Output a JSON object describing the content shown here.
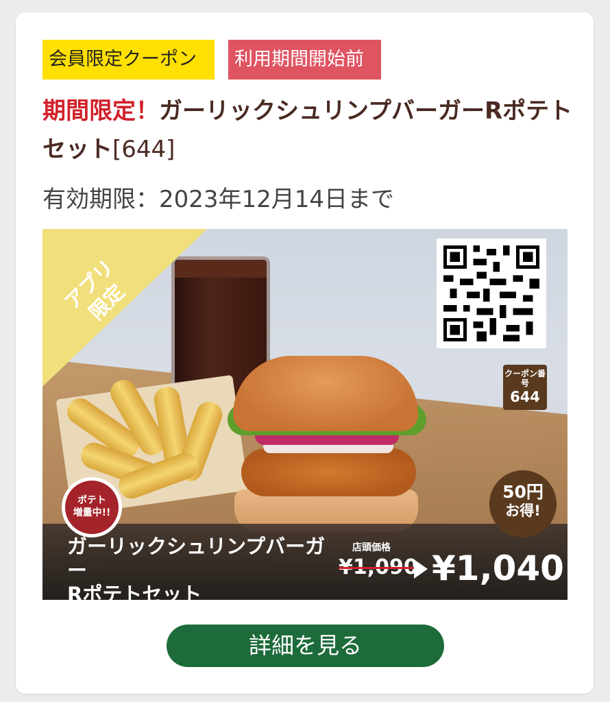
{
  "badges": {
    "member_only": "会員限定クーポン",
    "before_period": "利用期間開始前"
  },
  "coupon": {
    "title_prefix": "期間限定！",
    "title_main": "ガーリックシュリンプバーガーRポテトセット",
    "title_code": "[644]",
    "expiry": "有効期限：2023年12月14日まで"
  },
  "banner": {
    "corner_text_line1": "アプリ",
    "corner_text_line2": "限定",
    "coupon_number_label": "クーポン番号",
    "coupon_number": "644",
    "savings_line1": "50円",
    "savings_line2": "お得!",
    "potato_line1": "ポテト",
    "potato_line2": "増量中!!",
    "product_line1": "ガーリックシュリンプバーガー",
    "product_line2": "Rポテトセット",
    "store_price_label": "店頭価格",
    "old_price": "¥1,090",
    "new_price": "¥1,040"
  },
  "actions": {
    "details_label": "詳細を見る"
  },
  "colors": {
    "member_badge": "#ffe000",
    "period_badge": "#df5461",
    "title_accent": "#d1202a",
    "button": "#1d6b3a",
    "coupon_brown": "#5a3a1e"
  }
}
